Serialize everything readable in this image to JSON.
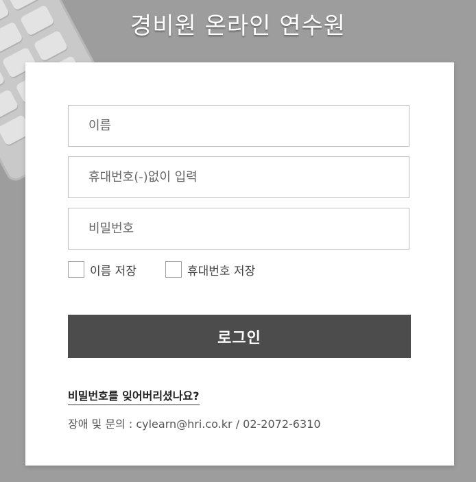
{
  "header": {
    "title": "경비원 온라인 연수원"
  },
  "login_form": {
    "name_placeholder": "이름",
    "phone_placeholder": "휴대번호(-)없이 입력",
    "password_placeholder": "비밀번호",
    "save_name_label": "이름 저장",
    "save_phone_label": "휴대번호 저장",
    "login_label": "로그인",
    "forgot_password_label": "비밀번호를 잊어버리셨나요?",
    "contact_text": "장애 및 문의 : cylearn@hri.co.kr / 02-2072-6310"
  },
  "colors": {
    "background": "#9d9d9d",
    "card": "#ffffff",
    "button": "#4c4c4c"
  }
}
